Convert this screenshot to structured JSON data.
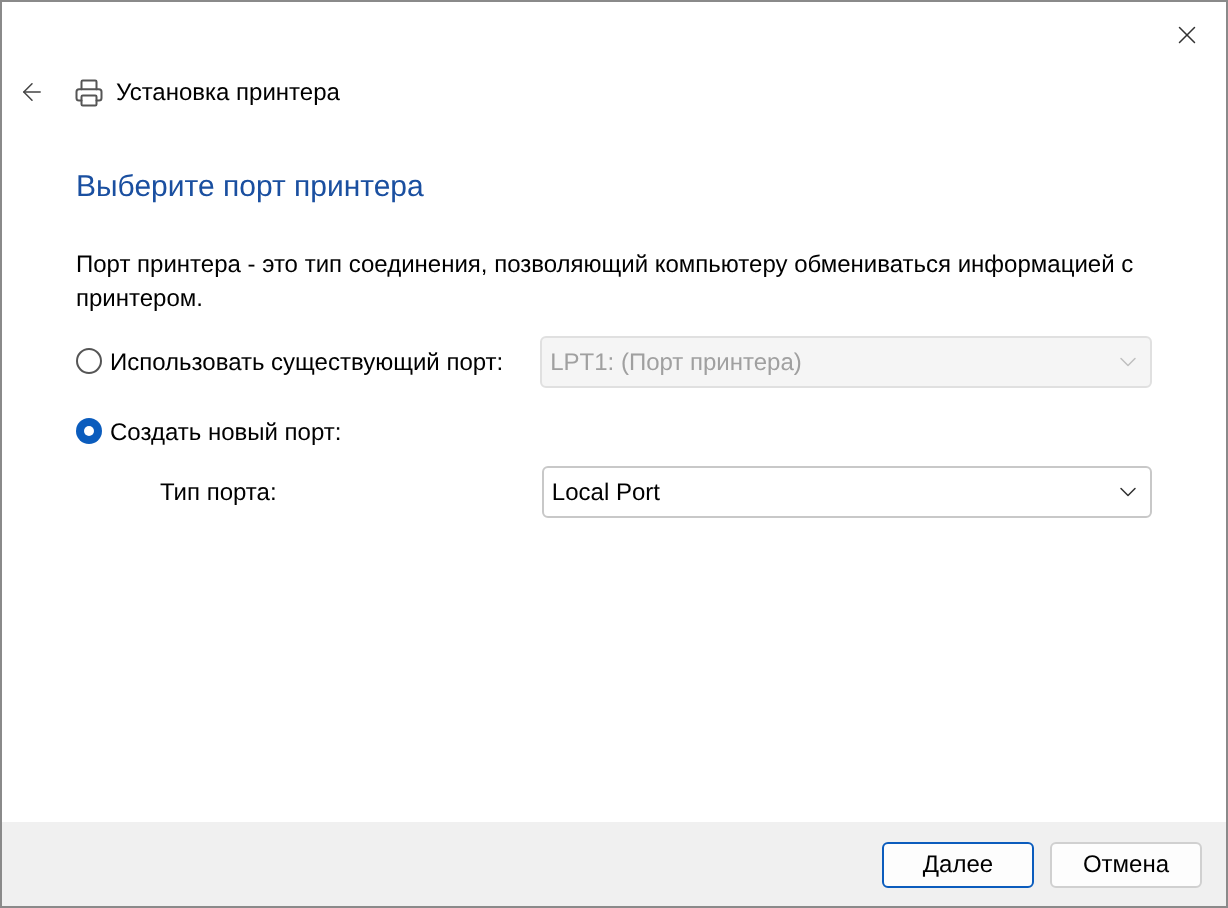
{
  "window": {
    "title": "Установка принтера"
  },
  "heading": "Выберите порт принтера",
  "description": "Порт принтера - это тип соединения, позволяющий компьютеру обмениваться информацией с принтером.",
  "options": [
    {
      "label": "Использовать существующий порт:",
      "selected": false,
      "dropdown": {
        "value": "LPT1: (Порт принтера)",
        "disabled": true
      }
    },
    {
      "label": "Создать новый порт:",
      "selected": true
    }
  ],
  "port_type": {
    "label": "Тип порта:",
    "value": "Local Port",
    "disabled": false
  },
  "buttons": [
    {
      "label": "Далее",
      "default": true
    },
    {
      "label": "Отмена",
      "default": false
    }
  ]
}
